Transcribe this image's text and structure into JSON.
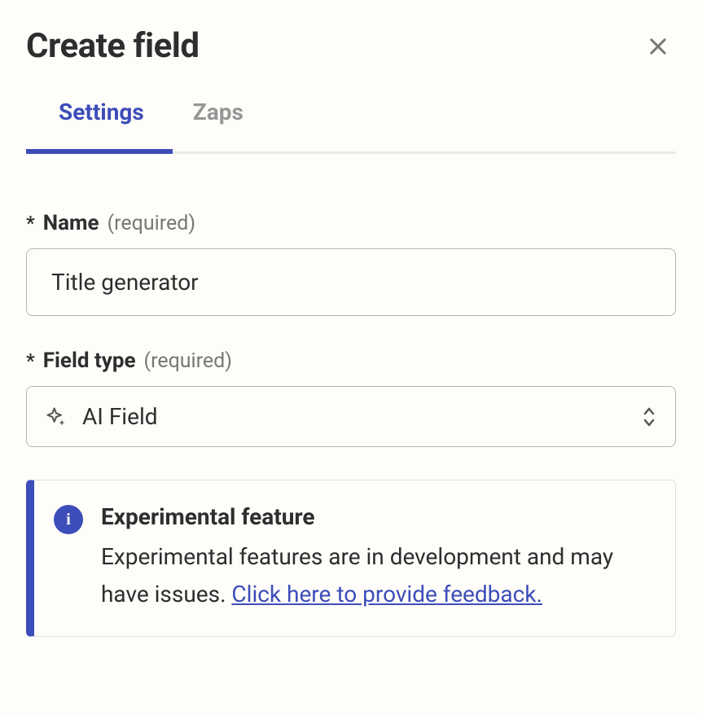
{
  "header": {
    "title": "Create field"
  },
  "tabs": {
    "items": [
      {
        "label": "Settings",
        "active": true
      },
      {
        "label": "Zaps",
        "active": false
      }
    ]
  },
  "form": {
    "name": {
      "asterisk": "*",
      "label": "Name",
      "required_text": "(required)",
      "value": "Title generator"
    },
    "field_type": {
      "asterisk": "*",
      "label": "Field type",
      "required_text": "(required)",
      "value": "AI Field"
    }
  },
  "callout": {
    "title": "Experimental feature",
    "text": "Experimental features are in development and may have issues. ",
    "link_text": "Click here to provide feedback."
  }
}
